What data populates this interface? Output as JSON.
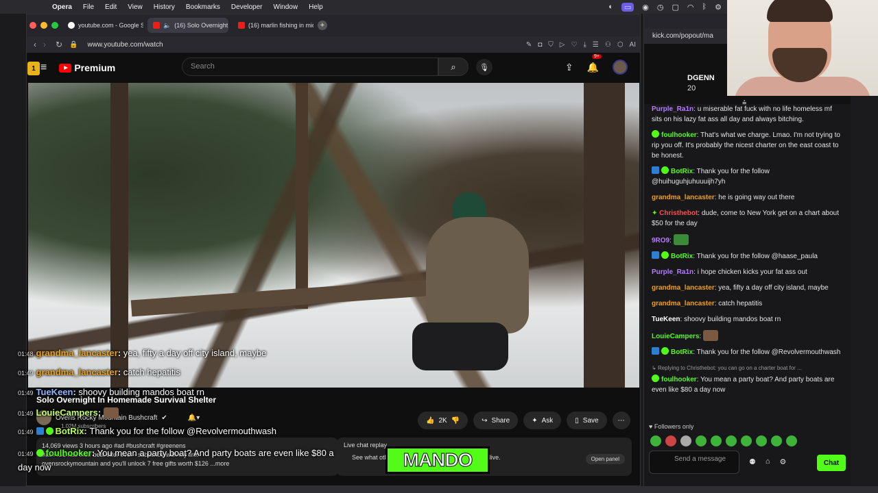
{
  "menubar": {
    "app": "Opera",
    "items": [
      "File",
      "Edit",
      "View",
      "History",
      "Bookmarks",
      "Developer",
      "Window",
      "Help"
    ]
  },
  "browser": {
    "tabs": [
      {
        "label": "youtube.com - Google S"
      },
      {
        "label": "(16) Solo Overnight"
      },
      {
        "label": "(16) marlin fishing in mid"
      }
    ],
    "url": "www.youtube.com/watch",
    "ai_label": "AI"
  },
  "youtube": {
    "logo": "Premium",
    "search_placeholder": "Search",
    "notif_badge": "9+",
    "video_title": "Solo Overnight In Homemade Survival Shelter",
    "channel": "Ovens Rocky Mountain Bushcraft",
    "subscribers": "1.02M subscribers",
    "likes": "2K",
    "share": "Share",
    "ask": "Ask",
    "save": "Save",
    "desc_stats": "14,069 views  3 hours ago  #ad #bushcraft #greenens",
    "desc_line2": "#ad AG1 has their best offer ever - subscribe with my link",
    "desc_line3": "ovensrockymountain and you'll unlock 7 free gifts worth $126",
    "desc_more": "...more",
    "live_label": "Live chat replay",
    "live_text": "See what others said about this video while it was live.",
    "open_panel": "Open panel"
  },
  "overlay_chat": [
    {
      "time": "01:48",
      "user": "grandma_lancaster",
      "color": "#e8a020",
      "msg": "yea, fifty a day off city island, maybe"
    },
    {
      "time": "01:49",
      "user": "grandma_lancaster",
      "color": "#e8a020",
      "msg": "catch hepatitis"
    },
    {
      "time": "01:49",
      "user": "TueKeen",
      "color": "#8fb3ff",
      "msg": "shoovy building mandos boat rn"
    },
    {
      "time": "01:49",
      "user": "LouieCampers",
      "color": "#c6ff6b",
      "msg": ""
    },
    {
      "time": "01:49",
      "user": "BotRix",
      "color": "#b8ff4a",
      "msg": "Thank you for the follow @Revolvermouthwash"
    },
    {
      "time": "01:49",
      "user": "foulhooker",
      "color": "#53fc18",
      "msg": "You mean a party boat? And party boats are even like $80 a day now"
    }
  ],
  "mando_logo": "MANDO",
  "kick": {
    "url": "kick.com/popout/ma",
    "streamer": "DGENN",
    "count": "20",
    "rank": "1",
    "chat": [
      {
        "user": "Purple_Ra1n",
        "color": "#b57cff",
        "msg": "u miserable fat fuck with no life homeless mf sits on his lazy fat ass all day and always bitching."
      },
      {
        "user": "foulhooker",
        "color": "#53fc18",
        "msg": "That's what we charge. Lmao. I'm not trying to rip you off. It's probably the nicest charter on the east coast to be honest."
      },
      {
        "user": "BotRix",
        "color": "#53fc18",
        "msg": "Thank you for the follow @huihuguhjuhuuuijh7yh"
      },
      {
        "user": "grandma_lancaster",
        "color": "#f1a00f",
        "msg": "he is going way out there"
      },
      {
        "user": "Christhebot",
        "color": "#ff4d4d",
        "msg": "dude, come to New York get on a chart about $50 for the day"
      },
      {
        "user": "9RO9",
        "color": "#b57cff",
        "msg": ""
      },
      {
        "user": "BotRix",
        "color": "#53fc18",
        "msg": "Thank you for the follow @haase_paula"
      },
      {
        "user": "Purple_Ra1n",
        "color": "#b57cff",
        "msg": "i hope chicken kicks your fat ass out"
      },
      {
        "user": "grandma_lancaster",
        "color": "#f1a00f",
        "msg": "yea, fifty a day off city island, maybe"
      },
      {
        "user": "grandma_lancaster",
        "color": "#f1a00f",
        "msg": "catch hepatitis"
      },
      {
        "user": "TueKeen",
        "color": "#ffffff",
        "msg": "shoovy building mandos boat rn"
      },
      {
        "user": "LouieCampers",
        "color": "#53fc18",
        "msg": ""
      },
      {
        "user": "BotRix",
        "color": "#53fc18",
        "msg": "Thank you for the follow @Revolvermouthwash"
      }
    ],
    "reply_context": "Replying to Christhebot: you can go on a charter boat for ...",
    "last": {
      "user": "foulhooker",
      "color": "#53fc18",
      "msg": "You mean a party boat? And party boats are even like $80 a day now"
    },
    "followers_only": "Followers only",
    "input_placeholder": "Send a message",
    "chat_button": "Chat"
  }
}
